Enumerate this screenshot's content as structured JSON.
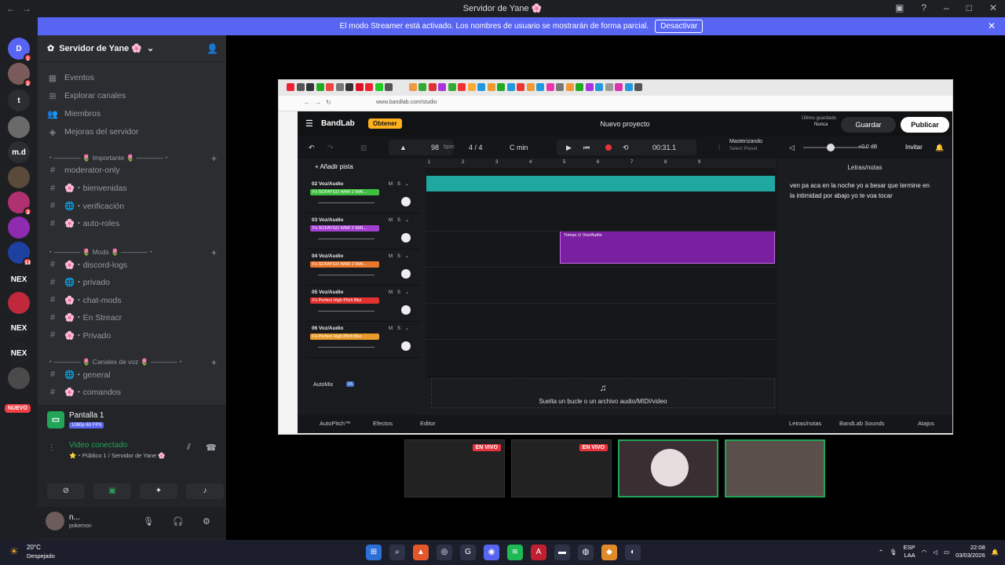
{
  "window": {
    "title": "Servidor de Yane 🌸"
  },
  "banner": {
    "text": "El modo Streamer está activado. Los nombres de usuario se mostrarán de forma parcial.",
    "button": "Desactivar"
  },
  "servers": {
    "items": [
      {
        "label": "D",
        "badge": "1",
        "color": "#5865f2"
      },
      {
        "label": "",
        "badge": "2",
        "color": "#7a5a5a"
      },
      {
        "label": "t",
        "badge": "",
        "color": "#2b2d31"
      },
      {
        "label": "",
        "badge": "",
        "color": "#6a6a6a"
      },
      {
        "label": "m.d",
        "badge": "",
        "color": "#2b2d31"
      },
      {
        "label": "",
        "badge": "",
        "color": "#5a4a3a"
      },
      {
        "label": "",
        "badge": "3",
        "color": "#b03070"
      },
      {
        "label": "",
        "badge": "",
        "color": "#8e2bb0"
      },
      {
        "label": "",
        "badge": "13",
        "color": "#1e40a0"
      },
      {
        "label": "NEX",
        "badge": "",
        "color": "#202124"
      },
      {
        "label": "",
        "badge": "",
        "color": "#c0283b"
      },
      {
        "label": "NEX",
        "badge": "",
        "color": "#202124"
      },
      {
        "label": "NEX",
        "badge": "",
        "color": "#202124"
      },
      {
        "label": "",
        "badge": "",
        "color": "#4a4a4a"
      }
    ],
    "nuevo": "NUEVO"
  },
  "guild": {
    "name": "Servidor de Yane 🌸",
    "top_items": [
      "Eventos",
      "Explorar canales",
      "Miembros",
      "Mejoras del servidor"
    ],
    "categories": [
      {
        "label": "・―――― 🌷 Importante 🌷 ――――・",
        "channels": [
          "moderator-only",
          "🌸・bienvenidas",
          "🌐・verificación",
          "🌸・auto-roles"
        ]
      },
      {
        "label": "・―――― 🌷 Mods 🌷 ――――・",
        "channels": [
          "🌸・discord-logs",
          "🌐・privado",
          "🌸・chat-mods",
          "🌸・En Streacr",
          "🌸・Privado"
        ]
      },
      {
        "label": "・―――― 🌷 Canales de voz 🌷 ――――・",
        "channels": [
          "🌐・general",
          "🌸・comandos"
        ]
      }
    ]
  },
  "voice": {
    "stream_title": "Pantalla 1",
    "stream_quality": "1080p 60 FPS",
    "status": "Video conectado",
    "channel": "⭐・Público 1 / Servidor de Yane 🌸"
  },
  "user": {
    "name": "n...",
    "status": "pokemon"
  },
  "browser": {
    "url": "www.bandlab.com/studio"
  },
  "bandlab": {
    "logo": "BandLab",
    "obtener": "Obtener",
    "project": "Nuevo proyecto",
    "saved_label": "Último guardado",
    "saved_value": "Nunca",
    "save": "Guardar",
    "publish": "Publicar",
    "bpm": "98",
    "bpm_unit": "bpm",
    "meter": "4 / 4",
    "key": "C min",
    "time": "00:31.1",
    "mastering": "Masterizando",
    "preset": "Select Preset",
    "db": "+0.0 dB",
    "invite": "Invitar",
    "add_track": "Añadir pista",
    "ruler": [
      "1",
      "2",
      "3",
      "4",
      "5",
      "6",
      "7",
      "8",
      "9"
    ],
    "tracks": [
      {
        "name": "02  Voz/Audio",
        "fx": "Fx SOFAYGO WAR 2 MAI...",
        "fxcolor": "#3fbf3f"
      },
      {
        "name": "03  Voz/Audio",
        "fx": "Fx SOFAYGO WAR 2 MAI...",
        "fxcolor": "#a23fcf"
      },
      {
        "name": "04  Voz/Audio",
        "fx": "Fx SOFAYGO WAR 2 MAI...",
        "fxcolor": "#e8762b"
      },
      {
        "name": "05  Voz/Audio",
        "fx": "Fx Perfect High Pitch Bkz",
        "fxcolor": "#e0322f"
      },
      {
        "name": "06  Voz/Audio",
        "fx": "Fx Perfect High Pitch Bkz",
        "fxcolor": "#e89a2b"
      }
    ],
    "clip_label": "Tomas ⊙  Voz/Audio",
    "notes_title": "Letras/notas",
    "lyrics": "ven pa aca en  la noche yo a besar que termine en la intimidad por abajo yo te voa tocar",
    "automix": "AutoMix",
    "automix_badge": "IA",
    "drop": "Suelta un bucle o un archivo audio/MIDI/video",
    "footer": [
      "AutoPitch™",
      "Efectos",
      "Editor",
      "Letras/notas",
      "BandLab Sounds",
      "Atajos"
    ]
  },
  "thumbs": {
    "live": "EN VIVO"
  },
  "taskbar": {
    "temp": "20°C",
    "weather": "Despejado",
    "lang1": "ESP",
    "lang2": "LAA",
    "time": "22:08",
    "date": "03/03/2026"
  }
}
